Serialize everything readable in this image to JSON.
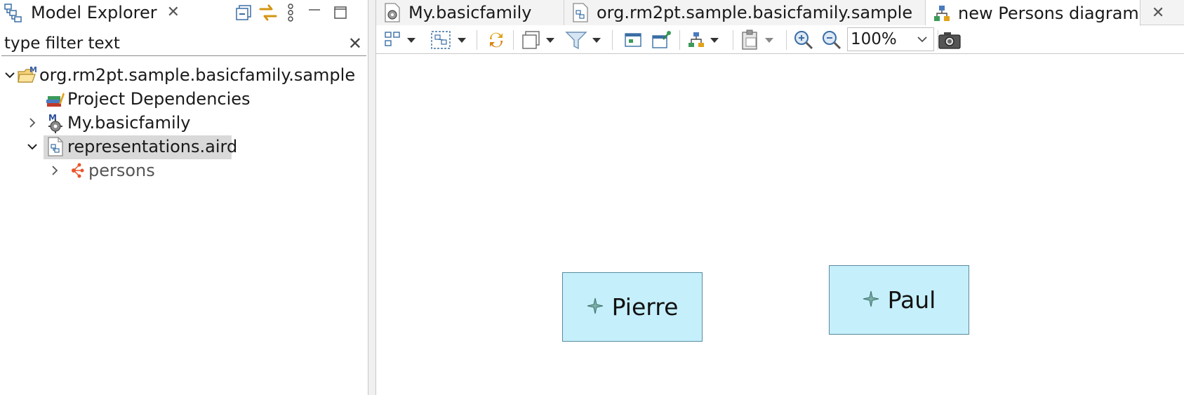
{
  "model_explorer": {
    "title": "Model Explorer",
    "filter_placeholder": "type filter text",
    "tree": [
      {
        "label": "org.rm2pt.sample.basicfamily.sample",
        "expanded": true,
        "icon": "project-folder-icon"
      },
      {
        "label": "Project Dependencies",
        "icon": "dependencies-icon"
      },
      {
        "label": "My.basicfamily",
        "expanded": false,
        "icon": "model-file-icon"
      },
      {
        "label": "representations.aird",
        "expanded": true,
        "selected": true,
        "icon": "aird-file-icon"
      },
      {
        "label": "persons",
        "expanded": false,
        "icon": "viewpoint-icon"
      }
    ]
  },
  "editor": {
    "tabs": [
      {
        "label": "My.basicfamily",
        "icon": "model-file-icon"
      },
      {
        "label": "org.rm2pt.sample.basicfamily.sample",
        "icon": "aird-file-icon"
      },
      {
        "label": "new Persons diagram",
        "icon": "diagram-icon",
        "active": true
      }
    ],
    "toolbar": {
      "zoom": "100%"
    },
    "diagram": {
      "nodes": [
        {
          "label": "Pierre",
          "icon": "sparkle-icon"
        },
        {
          "label": "Paul",
          "icon": "sparkle-icon"
        }
      ]
    }
  },
  "colors": {
    "node_fill": "#c5effb",
    "node_border": "#5a8aa0",
    "selection": "#d9d9d9"
  }
}
